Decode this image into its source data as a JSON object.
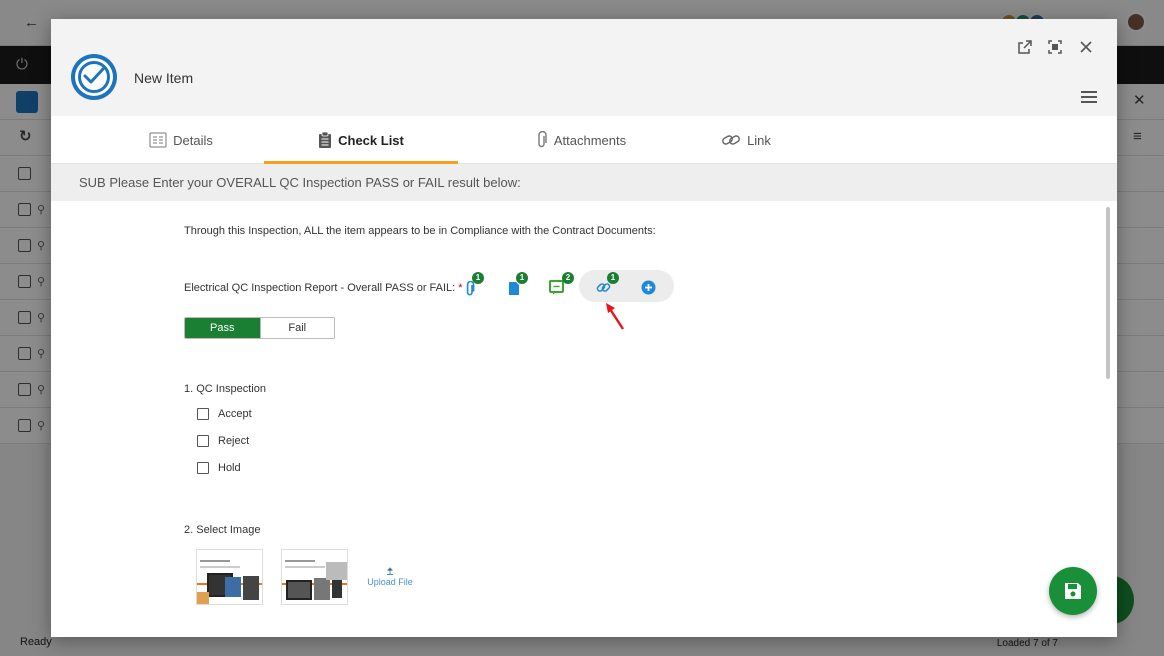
{
  "background_app": {
    "status_ready": "Ready",
    "status_loaded": "Loaded 7 of 7"
  },
  "modal": {
    "title": "New Item",
    "tabs": [
      {
        "label": "Details",
        "icon": "details-list-icon"
      },
      {
        "label": "Check List",
        "icon": "clipboard-icon"
      },
      {
        "label": "Attachments",
        "icon": "paperclip-icon"
      },
      {
        "label": "Link",
        "icon": "link-icon"
      }
    ],
    "section_banner": "SUB Please Enter your OVERALL QC Inspection PASS or FAIL result below:",
    "compliance_text": "Through this Inspection, ALL the item appears to be in Compliance with the Contract Documents:",
    "question": {
      "label": "Electrical QC Inspection Report - Overall PASS or FAIL:",
      "required_mark": "*",
      "badges": {
        "attachments": "1",
        "documents": "1",
        "comments": "2",
        "links": "1"
      },
      "options": [
        "Pass",
        "Fail"
      ],
      "selected": "Pass"
    },
    "qc_inspection": {
      "title": "1. QC Inspection",
      "options": [
        "Accept",
        "Reject",
        "Hold"
      ]
    },
    "select_image": {
      "title": "2. Select Image",
      "upload_label": "Upload File"
    },
    "colors": {
      "accent_green": "#1a7f32",
      "tab_underline": "#f5a01a",
      "brand_blue": "#1e73be",
      "required_red": "#d0021b"
    }
  }
}
